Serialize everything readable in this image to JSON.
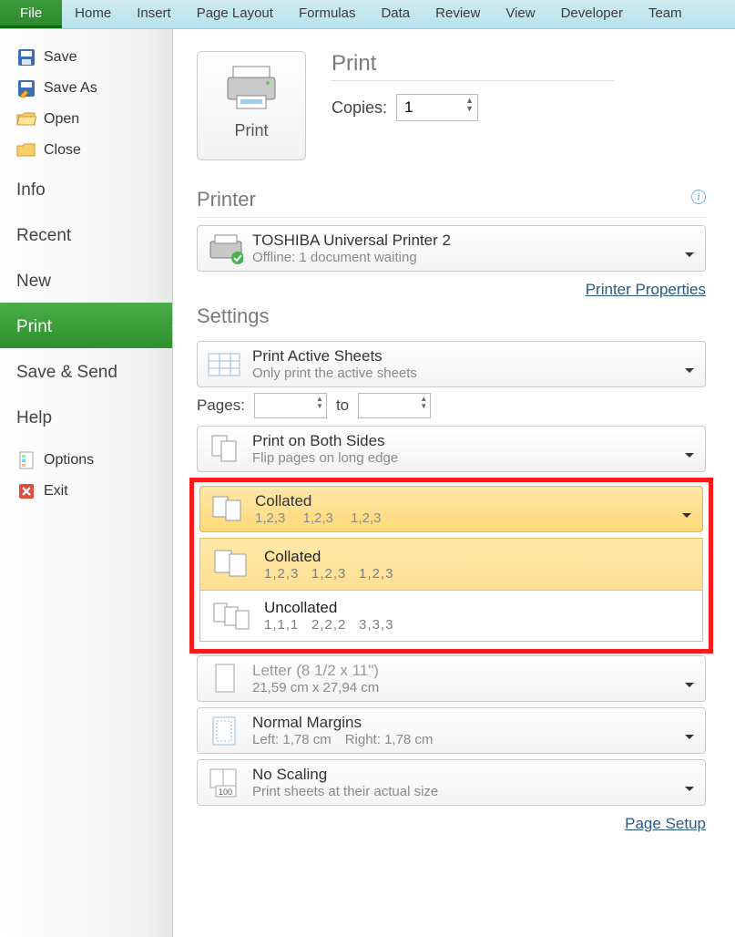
{
  "ribbon": {
    "file": "File",
    "tabs": [
      "Home",
      "Insert",
      "Page Layout",
      "Formulas",
      "Data",
      "Review",
      "View",
      "Developer",
      "Team"
    ]
  },
  "sidebar": {
    "quick": {
      "save": "Save",
      "save_as": "Save As",
      "open": "Open",
      "close": "Close"
    },
    "sections": {
      "info": "Info",
      "recent": "Recent",
      "new": "New",
      "print": "Print",
      "save_send": "Save & Send",
      "help": "Help"
    },
    "bottom": {
      "options": "Options",
      "exit": "Exit"
    }
  },
  "print": {
    "button_label": "Print",
    "title": "Print",
    "copies_label": "Copies:",
    "copies_value": "1"
  },
  "printer": {
    "section": "Printer",
    "name": "TOSHIBA Universal Printer 2",
    "status": "Offline: 1 document waiting",
    "properties": "Printer Properties"
  },
  "settings": {
    "section": "Settings",
    "scope": {
      "t1": "Print Active Sheets",
      "t2": "Only print the active sheets"
    },
    "pages_label": "Pages:",
    "pages_to": "to",
    "duplex": {
      "t1": "Print on Both Sides",
      "t2": "Flip pages on long edge"
    },
    "collate_selected": {
      "t1": "Collated",
      "t2": "1,2,3  1,2,3  1,2,3"
    },
    "collate_options": {
      "collated": {
        "t1": "Collated",
        "t2": "1,2,3  1,2,3  1,2,3"
      },
      "uncollated": {
        "t1": "Uncollated",
        "t2": "1,1,1  2,2,2  3,3,3"
      }
    },
    "paper": {
      "t1": "Letter (8 1/2 x 11\")",
      "t2": "21,59 cm x 27,94 cm"
    },
    "margins": {
      "t1": "Normal Margins",
      "t2": "Left: 1,78 cm Right: 1,78 cm"
    },
    "scaling": {
      "t1": "No Scaling",
      "t2": "Print sheets at their actual size"
    },
    "page_setup": "Page Setup"
  }
}
